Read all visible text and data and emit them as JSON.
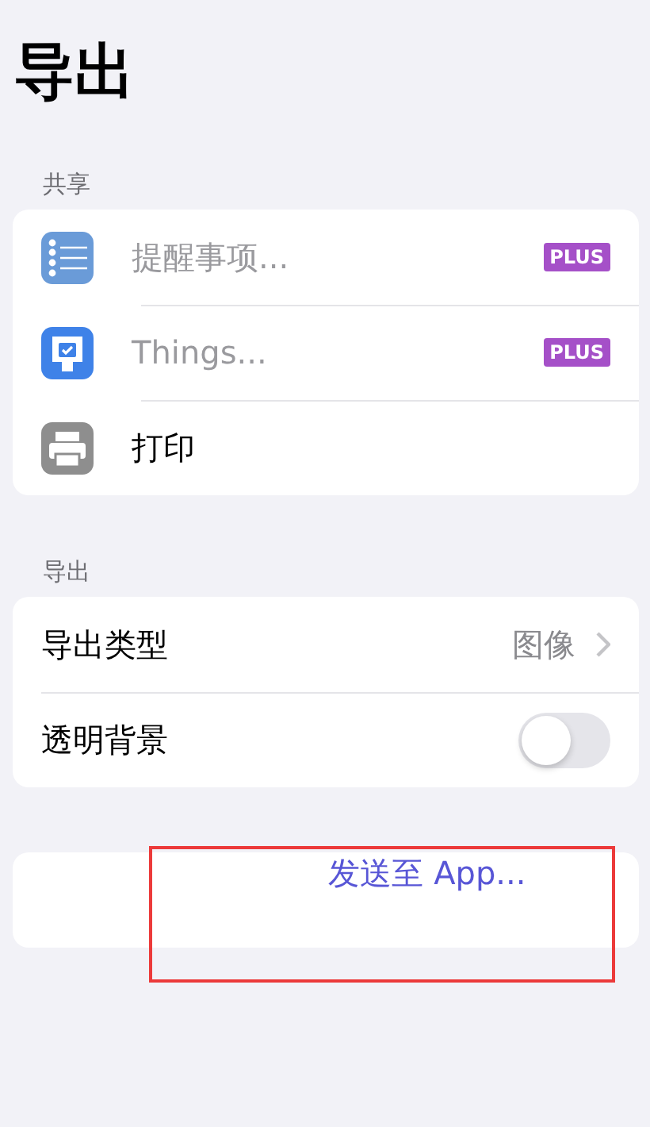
{
  "title": "导出",
  "sections": [
    {
      "header": "共享",
      "rows": [
        {
          "kind": "app",
          "label": "提醒事项...",
          "disabled": true,
          "badge": "PLUS"
        },
        {
          "kind": "app",
          "label": "Things...",
          "disabled": true,
          "badge": "PLUS"
        },
        {
          "kind": "app",
          "label": "打印",
          "disabled": false
        }
      ]
    },
    {
      "header": "导出",
      "rows": [
        {
          "kind": "nav",
          "label": "导出类型",
          "value": "图像"
        },
        {
          "kind": "toggle",
          "label": "透明背景",
          "on": false
        }
      ]
    }
  ],
  "send_button": {
    "label": "发送至 App...",
    "highlighted": true
  }
}
